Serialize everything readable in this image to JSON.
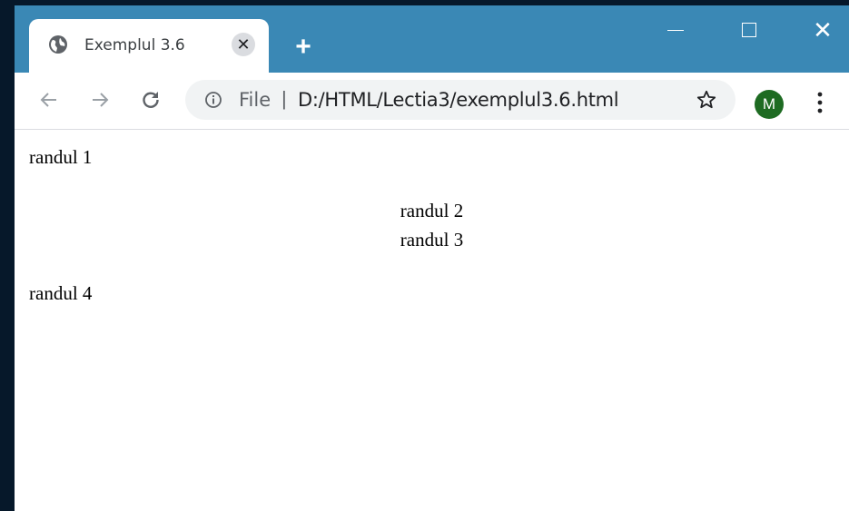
{
  "browser": {
    "tab": {
      "title": "Exemplul 3.6",
      "close_glyph": "✕",
      "icon": "globe-icon"
    },
    "new_tab_glyph": "+",
    "window_controls": {
      "close_glyph": "✕"
    },
    "address_bar": {
      "scheme_label": "File",
      "separator": "|",
      "url": "D:/HTML/Lectia3/exemplul3.6.html"
    },
    "profile": {
      "initial": "M",
      "color": "#1e6b22"
    },
    "colors": {
      "titlebar": "#3a88b5",
      "desktop": "#06182a"
    }
  },
  "page": {
    "lines": [
      "randul 1",
      "randul 2",
      "randul 3",
      "randul 4"
    ]
  }
}
